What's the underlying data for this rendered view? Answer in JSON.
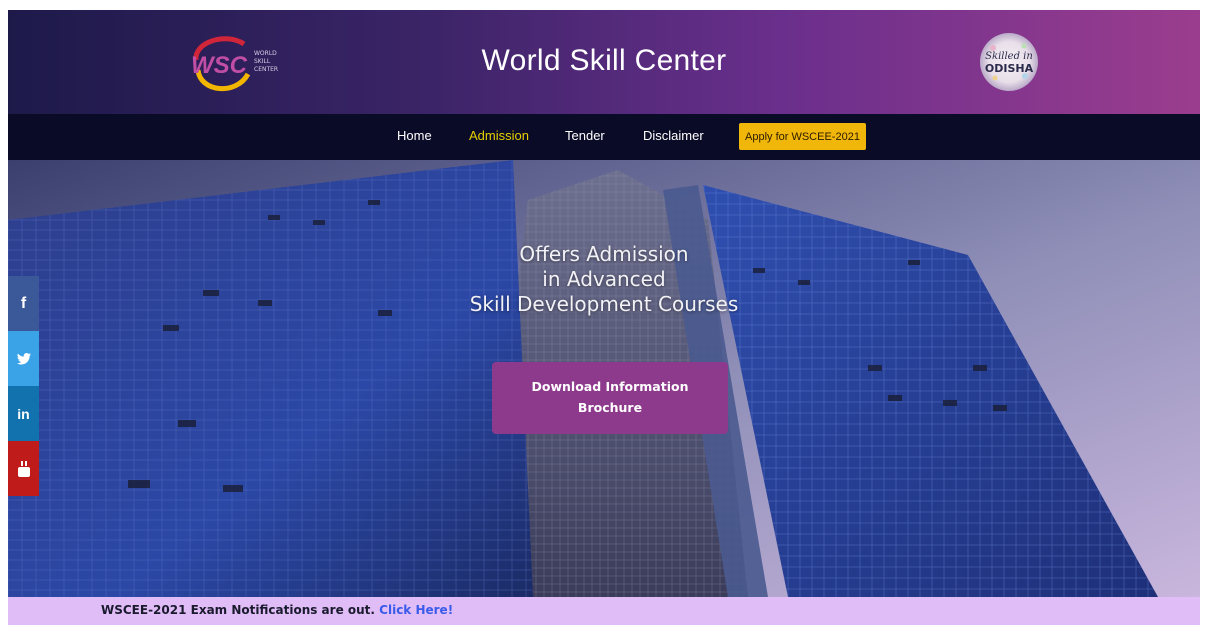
{
  "header": {
    "logo_text": "WSC",
    "logo_sub": [
      "WORLD",
      "SKILL",
      "CENTER"
    ],
    "title": "World Skill Center",
    "odisha_logo_text": [
      "Skilled in",
      "ODISHA"
    ]
  },
  "nav": {
    "items": [
      {
        "label": "Home",
        "active": false
      },
      {
        "label": "Admission",
        "active": true
      },
      {
        "label": "Tender",
        "active": false
      },
      {
        "label": "Disclaimer",
        "active": false
      }
    ],
    "apply_label": "Apply for WSCEE-2021"
  },
  "hero": {
    "lines": [
      "Offers Admission",
      "in Advanced",
      "Skill Development Courses"
    ],
    "download": {
      "line1": "Download Information",
      "line2": "Brochure"
    }
  },
  "social": [
    {
      "name": "facebook-icon",
      "glyph": "f",
      "color": "#3b5998"
    },
    {
      "name": "twitter-icon",
      "glyph": "🐦",
      "color": "#3aa3e8"
    },
    {
      "name": "linkedin-icon",
      "glyph": "in",
      "color": "#1272ae"
    },
    {
      "name": "youtube-icon",
      "glyph": "You Tube",
      "color": "#c01b1b"
    }
  ],
  "ticker": {
    "text": "WSCEE-2021 Exam Notifications are out.",
    "link": "Click Here!"
  },
  "colors": {
    "nav_active": "#e7d000",
    "apply_button": "#f1b60a",
    "download_button": "#8e3a8c",
    "ticker_bg": "#e0bdf7"
  }
}
